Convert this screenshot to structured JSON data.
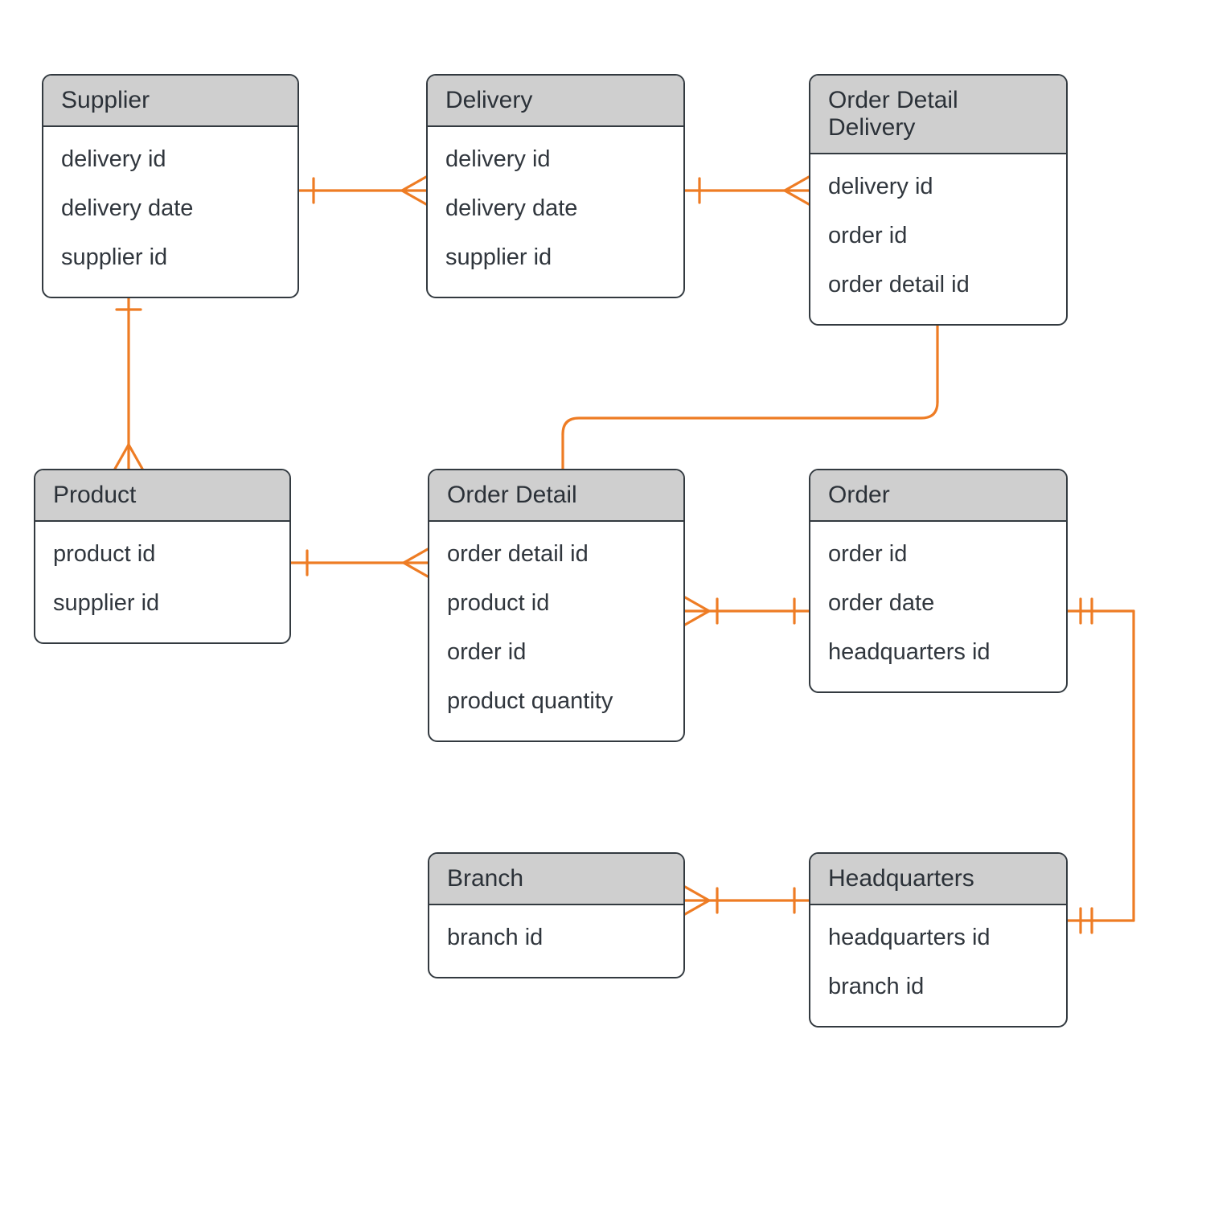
{
  "entities": {
    "supplier": {
      "title": "Supplier",
      "attrs": [
        "delivery id",
        "delivery date",
        "supplier id"
      ]
    },
    "delivery": {
      "title": "Delivery",
      "attrs": [
        "delivery id",
        "delivery date",
        "supplier id"
      ]
    },
    "orderDetailDelivery": {
      "title": "Order Detail Delivery",
      "attrs": [
        "delivery id",
        "order id",
        "order detail id"
      ]
    },
    "product": {
      "title": "Product",
      "attrs": [
        "product id",
        "supplier id"
      ]
    },
    "orderDetail": {
      "title": "Order Detail",
      "attrs": [
        "order detail id",
        "product id",
        "order id",
        "product quantity"
      ]
    },
    "order": {
      "title": "Order",
      "attrs": [
        "order id",
        "order date",
        "headquarters id"
      ]
    },
    "branch": {
      "title": "Branch",
      "attrs": [
        "branch id"
      ]
    },
    "headquarters": {
      "title": "Headquarters",
      "attrs": [
        "headquarters id",
        "branch id"
      ]
    }
  },
  "colors": {
    "connector": "#ee7c24",
    "entityBorder": "#333a40",
    "entityHeaderBg": "#cfcfcf"
  }
}
